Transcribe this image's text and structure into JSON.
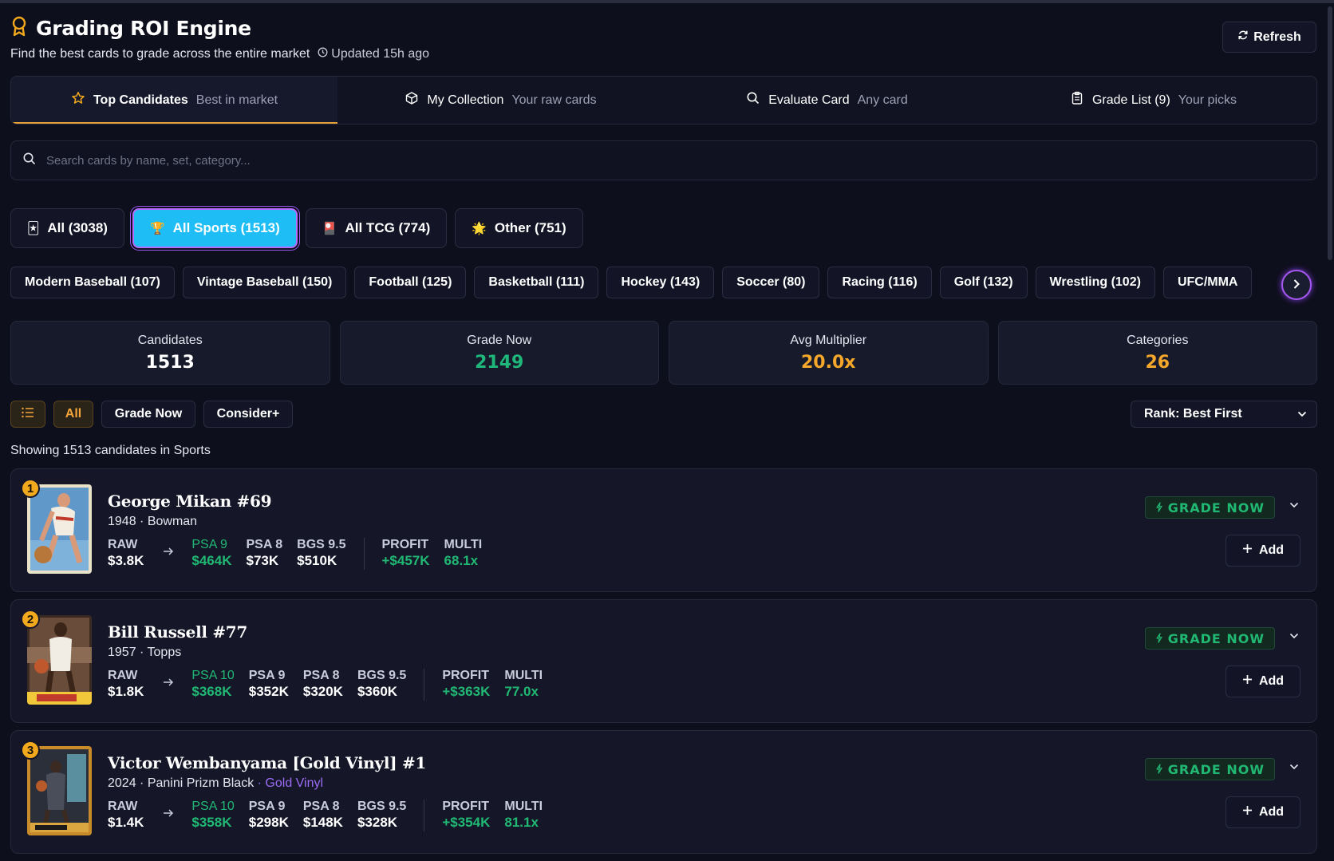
{
  "header": {
    "title": "Grading ROI Engine",
    "subtitle": "Find the best cards to grade across the entire market",
    "updated": "Updated 15h ago",
    "refresh_label": "Refresh"
  },
  "tabs": [
    {
      "label": "Top Candidates",
      "hint": "Best in market",
      "icon": "star-icon"
    },
    {
      "label": "My Collection",
      "hint": "Your raw cards",
      "icon": "box-icon"
    },
    {
      "label": "Evaluate Card",
      "hint": "Any card",
      "icon": "search-icon"
    },
    {
      "label": "Grade List (9)",
      "hint": "Your picks",
      "icon": "clipboard-icon"
    }
  ],
  "search": {
    "placeholder": "Search cards by name, set, category..."
  },
  "filters": [
    {
      "label": "All (3038)",
      "emoji": "🃏"
    },
    {
      "label": "All Sports (1513)",
      "emoji": "🏆"
    },
    {
      "label": "All TCG (774)",
      "emoji": "🎴"
    },
    {
      "label": "Other (751)",
      "emoji": "🌟"
    }
  ],
  "chips": [
    "Modern Baseball (107)",
    "Vintage Baseball (150)",
    "Football (125)",
    "Basketball (111)",
    "Hockey (143)",
    "Soccer (80)",
    "Racing (116)",
    "Golf (132)",
    "Wrestling (102)",
    "UFC/MMA"
  ],
  "stats": [
    {
      "label": "Candidates",
      "value": "1513",
      "color": "#ffffff"
    },
    {
      "label": "Grade Now",
      "value": "2149",
      "color": "#1fb77a"
    },
    {
      "label": "Avg Multiplier",
      "value": "20.0x",
      "color": "#f4a72a"
    },
    {
      "label": "Categories",
      "value": "26",
      "color": "#f4a72a"
    }
  ],
  "toolbar": {
    "all": "All",
    "grade_now": "Grade Now",
    "consider": "Consider+",
    "sort": "Rank: Best First"
  },
  "showing": "Showing 1513 candidates in Sports",
  "cards": [
    {
      "rank": "1",
      "name": "George Mikan #69",
      "meta": "1948 · Bowman",
      "variant": "",
      "raw_label": "RAW",
      "raw": "$3.8K",
      "grades": [
        {
          "label": "PSA 9",
          "value": "$464K",
          "green": true
        },
        {
          "label": "PSA 8",
          "value": "$73K",
          "green": false
        },
        {
          "label": "BGS 9.5",
          "value": "$510K",
          "green": false
        }
      ],
      "profit_label": "PROFIT",
      "profit": "+$457K",
      "multi_label": "MULTI",
      "multi": "68.1x",
      "badge": "GRADE NOW",
      "add": "Add"
    },
    {
      "rank": "2",
      "name": "Bill Russell #77",
      "meta": "1957 · Topps",
      "variant": "",
      "raw_label": "RAW",
      "raw": "$1.8K",
      "grades": [
        {
          "label": "PSA 10",
          "value": "$368K",
          "green": true
        },
        {
          "label": "PSA 9",
          "value": "$352K",
          "green": false
        },
        {
          "label": "PSA 8",
          "value": "$320K",
          "green": false
        },
        {
          "label": "BGS 9.5",
          "value": "$360K",
          "green": false
        }
      ],
      "profit_label": "PROFIT",
      "profit": "+$363K",
      "multi_label": "MULTI",
      "multi": "77.0x",
      "badge": "GRADE NOW",
      "add": "Add"
    },
    {
      "rank": "3",
      "name": "Victor Wembanyama [Gold Vinyl] #1",
      "meta": "2024 · Panini Prizm Black",
      "variant": "· Gold Vinyl",
      "raw_label": "RAW",
      "raw": "$1.4K",
      "grades": [
        {
          "label": "PSA 10",
          "value": "$358K",
          "green": true
        },
        {
          "label": "PSA 9",
          "value": "$298K",
          "green": false
        },
        {
          "label": "PSA 8",
          "value": "$148K",
          "green": false
        },
        {
          "label": "BGS 9.5",
          "value": "$328K",
          "green": false
        }
      ],
      "profit_label": "PROFIT",
      "profit": "+$354K",
      "multi_label": "MULTI",
      "multi": "81.1x",
      "badge": "GRADE NOW",
      "add": "Add"
    }
  ]
}
